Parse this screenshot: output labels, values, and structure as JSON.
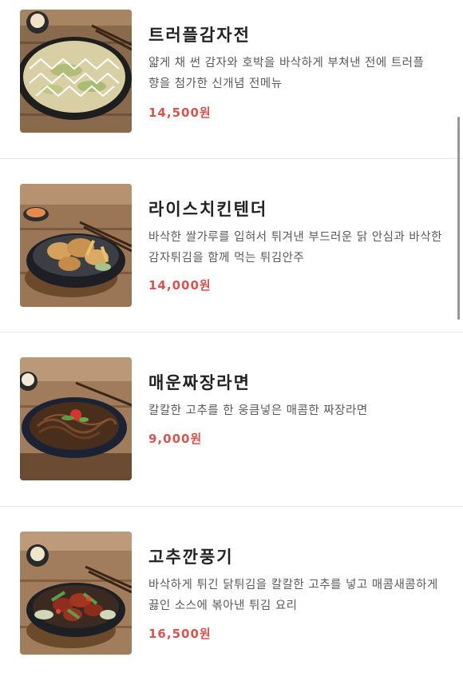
{
  "menu": {
    "items": [
      {
        "name": "트러플감자전",
        "description": "얇게 채 썬 감자와 호박을 바삭하게 부쳐낸 전에 트러플 향을 첨가한 신개념 전메뉴",
        "price": "14,500원",
        "image_icon": "potato-pancake-photo"
      },
      {
        "name": "라이스치킨텐더",
        "description": "바삭한 쌀가루를 입혀서 튀겨낸 부드러운 닭 안심과 바삭한 감자튀김을 함께 먹는 튀김안주",
        "price": "14,000원",
        "image_icon": "rice-chicken-tender-photo"
      },
      {
        "name": "매운짜장라면",
        "description": "칼칼한 고추를 한 웅큼넣은 매콤한 짜장라면",
        "price": "9,000원",
        "image_icon": "spicy-jjajang-ramen-photo"
      },
      {
        "name": "고추깐풍기",
        "description": "바삭하게 튀긴 닭튀김을 칼칼한 고추를 넣고 매콤새콤하게 끓인 소스에 볶아낸 튀김 요리",
        "price": "16,500원",
        "image_icon": "pepper-kkanpunggi-photo"
      }
    ]
  },
  "colors": {
    "price": "#d9534f",
    "title": "#222222",
    "description": "#5a5a5a",
    "divider": "#e9e9e9"
  }
}
